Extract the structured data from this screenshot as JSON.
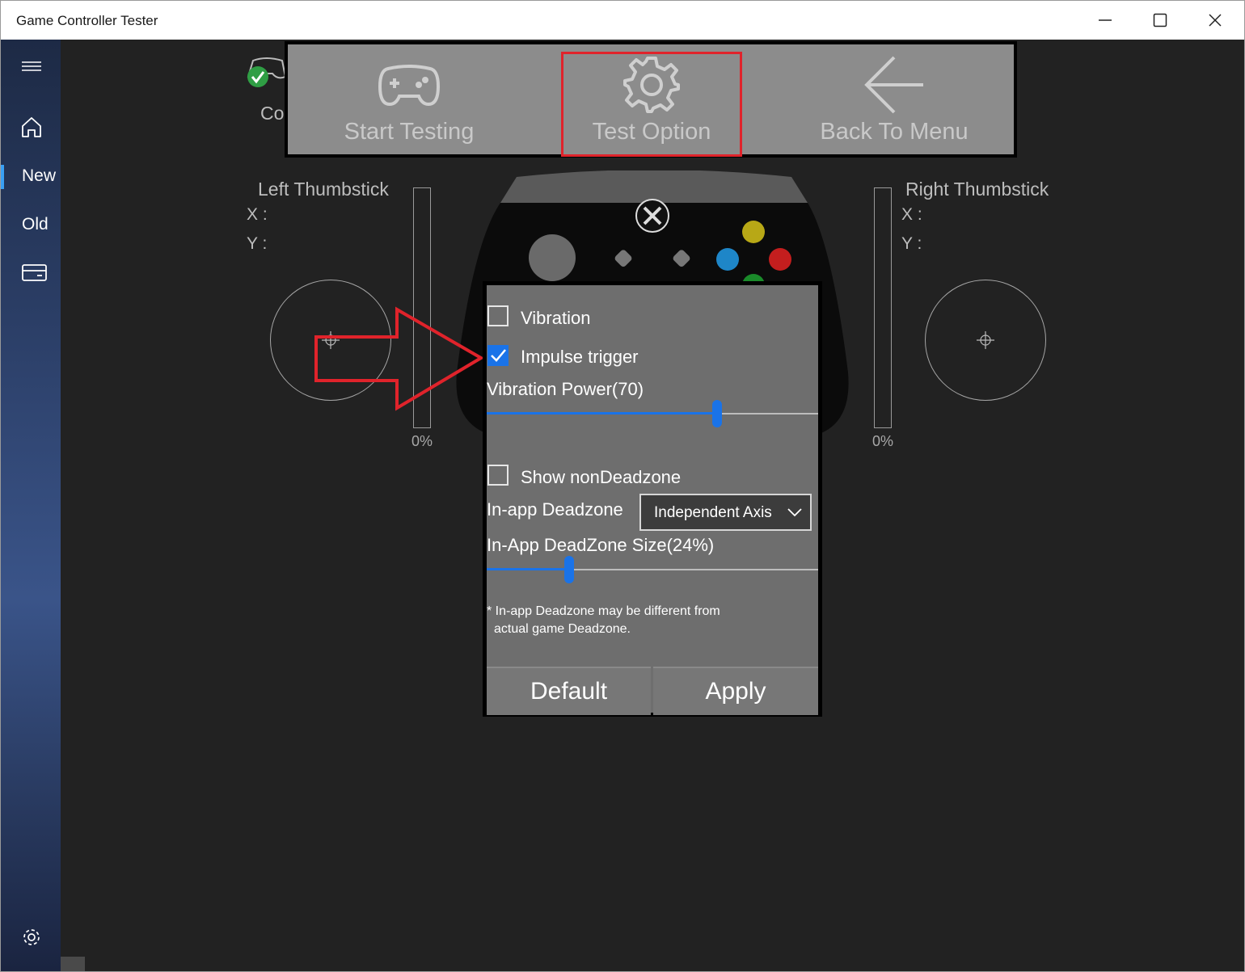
{
  "window": {
    "title": "Game Controller Tester"
  },
  "sidebar": {
    "menu_icon": "hamburger-icon",
    "home_icon": "home-icon",
    "items": [
      {
        "label": "New",
        "selected": true
      },
      {
        "label": "Old",
        "selected": false
      }
    ],
    "wallet_icon": "card-icon",
    "settings_icon": "gear-icon"
  },
  "behind_text": "Co",
  "toolbar": {
    "start_label": "Start Testing",
    "option_label": "Test Option",
    "back_label": "Back To Menu"
  },
  "left_stick": {
    "title": "Left Thumbstick",
    "x_label": "X :",
    "y_label": "Y :",
    "trigger_pct": "0%"
  },
  "right_stick": {
    "title": "Right Thumbstick",
    "x_label": "X :",
    "y_label": "Y :",
    "trigger_pct": "0%"
  },
  "options_panel": {
    "vibration_label": "Vibration",
    "vibration_checked": false,
    "impulse_label": "Impulse trigger",
    "impulse_checked": true,
    "power_label": "Vibration Power(70)",
    "power_value": 70,
    "show_nondeadzone_label": "Show nonDeadzone",
    "show_nondeadzone_checked": false,
    "deadzone_label": "In-app Deadzone",
    "deadzone_select": "Independent Axis",
    "deadzone_size_label": "In-App DeadZone Size(24%)",
    "deadzone_size_value": 24,
    "note_line1": "* In-app Deadzone may be different from",
    "note_line2": "actual game Deadzone.",
    "default_label": "Default",
    "apply_label": "Apply"
  },
  "colors": {
    "accent": "#1a73e8",
    "highlight": "#e0232b"
  }
}
